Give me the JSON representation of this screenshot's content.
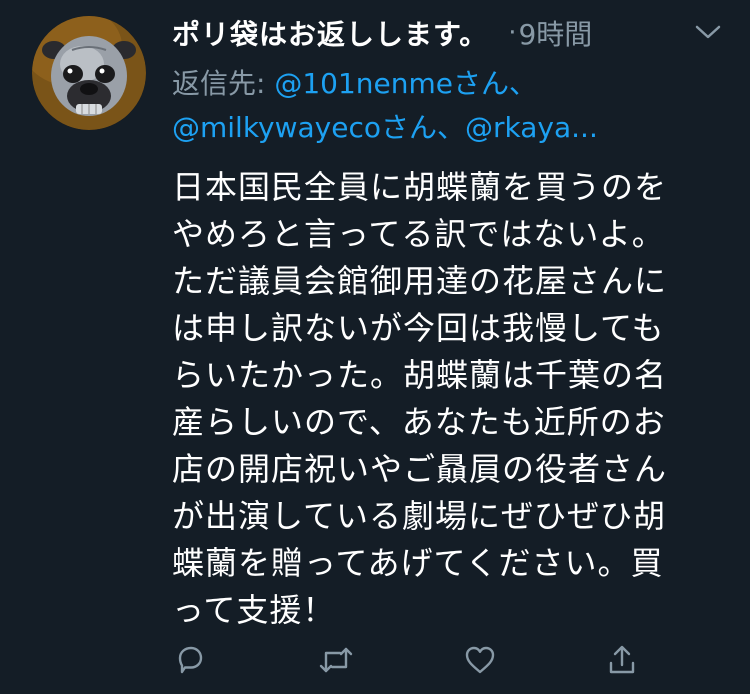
{
  "tweet": {
    "display_name": "ポリ袋はお返しします。",
    "separator": "·",
    "timestamp": "9時間",
    "reply_to": {
      "prefix": "返信先: ",
      "mention_1": "@101nenmeさん、",
      "mention_2": "@milkywayecoさん、",
      "mention_3": "@rkaya..."
    },
    "body_lines": [
      "日本国民全員に胡蝶蘭を買うのを",
      "やめろと言ってる訳ではないよ。",
      "ただ議員会館御用達の花屋さんに",
      "は申し訳ないが今回は我慢しても",
      "らいたかった。胡蝶蘭は千葉の名",
      "産らしいので、あなたも近所のお",
      "店の開店祝いやご贔屓の役者さん",
      "が出演している劇場にぜひぜひ胡",
      "蝶蘭を贈ってあげてください。買",
      "って支援！"
    ]
  },
  "icons": {
    "chevron": "chevron-down-icon",
    "reply": "reply-icon",
    "retweet": "retweet-icon",
    "like": "heart-icon",
    "share": "share-icon"
  },
  "colors": {
    "background": "#141d26",
    "text": "#ffffff",
    "secondary": "#8899a6",
    "link": "#1da1f2"
  }
}
